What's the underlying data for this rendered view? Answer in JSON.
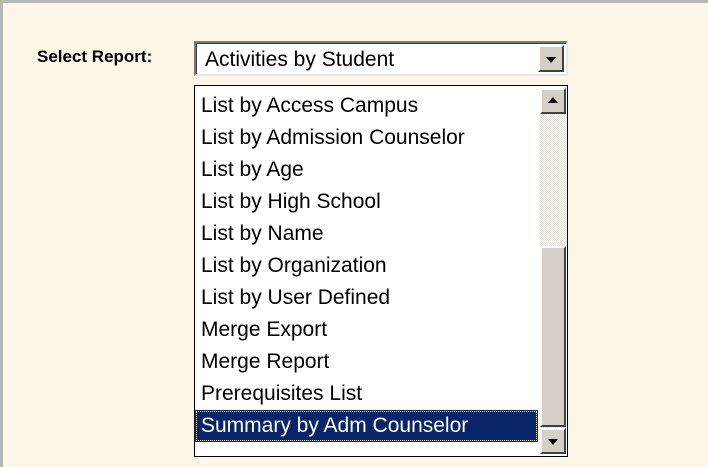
{
  "form": {
    "label": "Select Report:",
    "selected_value": "Activities by Student"
  },
  "dropdown": {
    "options": [
      "List by Access Campus",
      "List by Admission Counselor",
      "List by Age",
      "List by High School",
      "List by Name",
      "List by Organization",
      "List by User Defined",
      "Merge Export",
      "Merge Report",
      "Prerequisites List",
      "Summary by Adm Counselor"
    ],
    "highlighted_option": "Summary by Adm Counselor",
    "scroll_position": 1.0
  },
  "icons": {
    "select_button": "chevron-down-icon",
    "scroll_up": "arrow-up-icon",
    "scroll_down": "arrow-down-icon"
  },
  "colors": {
    "panel_background": "#fcf7e6",
    "selection_background": "#0a246a",
    "selection_text": "#ffffff"
  }
}
